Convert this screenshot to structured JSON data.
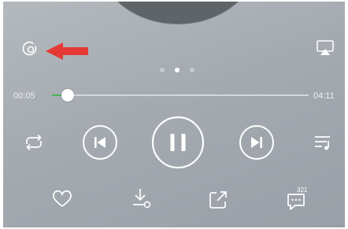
{
  "player": {
    "elapsed_time": "00:05",
    "total_time": "04:11",
    "progress_fraction": 0.06,
    "carousel": {
      "page_count": 3,
      "active_index": 1
    },
    "comment_count": "321"
  },
  "colors": {
    "annotation_arrow": "#e53935",
    "progress_fill": "#4db35a",
    "icon": "#ffffff"
  },
  "icons": {
    "top_left": "audio-effect-icon",
    "top_right": "airplay-icon",
    "repeat": "repeat-icon",
    "previous": "previous-track-icon",
    "play_pause": "pause-icon",
    "next": "next-track-icon",
    "playlist": "playlist-icon",
    "like": "heart-icon",
    "download": "download-icon",
    "share": "share-icon",
    "comments": "comment-icon"
  }
}
